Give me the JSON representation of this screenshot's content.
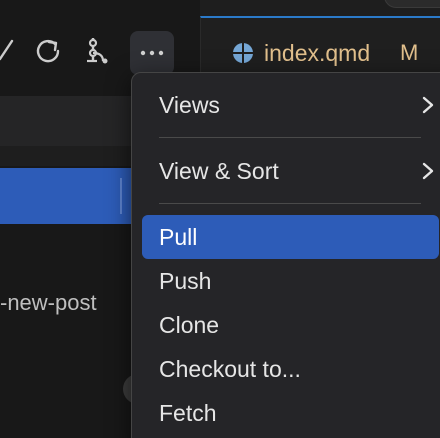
{
  "toolbar": {
    "icons": [
      "check-icon",
      "refresh-icon",
      "git-graph-icon",
      "more-actions-icon"
    ]
  },
  "scm": {
    "branch_label": "-new-post"
  },
  "editor": {
    "tab_title": "index.qmd",
    "tab_status": "M",
    "tab_icon": "quarto-globe-icon",
    "accent_color": "#2b7ac9",
    "modified_color": "#e2c08d"
  },
  "menu": {
    "items": [
      {
        "label": "Views",
        "submenu": true
      },
      {
        "label": "View & Sort",
        "submenu": true
      },
      {
        "label": "Pull",
        "selected": true
      },
      {
        "label": "Push"
      },
      {
        "label": "Clone"
      },
      {
        "label": "Checkout to..."
      },
      {
        "label": "Fetch"
      }
    ],
    "selection_color": "#2d5cb8"
  }
}
